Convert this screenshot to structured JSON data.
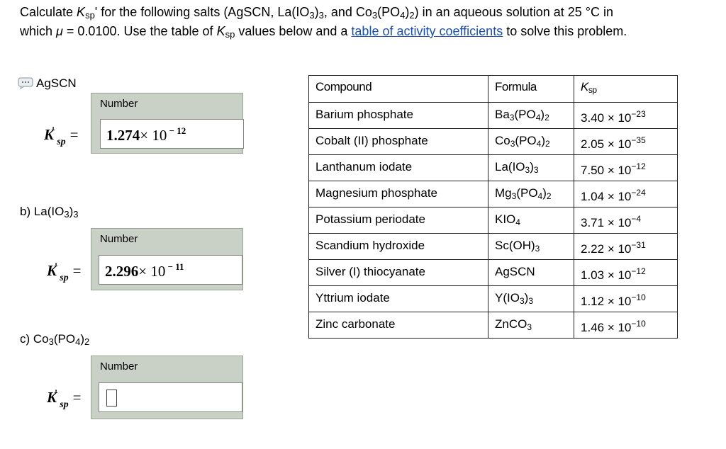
{
  "prompt": {
    "line1_a": "Calculate ",
    "k_symbol": "K",
    "k_sub": "sp",
    "line1_b": "' for the following salts (AgSCN, La(IO",
    "sub3": "3",
    "line1_c": ")",
    "line1_d": ", and Co",
    "line1_e": "(PO",
    "sub4": "4",
    "sub2": "2",
    "line1_f": ") in an aqueous solution at 25 °C in",
    "line2_a": "which ",
    "mu": "μ",
    "line2_b": " = 0.0100. Use the table of ",
    "line2_c": " values below and a ",
    "link_text": "table of activity coefficients",
    "line2_d": " to solve this problem."
  },
  "parts": {
    "a": {
      "label": "AgSCN",
      "box_title": "Number",
      "value_mantissa": "1.274",
      "value_times": "× 10",
      "value_exp": " − 12"
    },
    "b": {
      "label_pre": "b) La(IO",
      "label_sub": "3",
      "label_post": ")",
      "label_sub2": "3",
      "box_title": "Number",
      "value_mantissa": "2.296",
      "value_times": "× 10",
      "value_exp": " − 11"
    },
    "c": {
      "label_pre": "c) Co",
      "label_sub": "3",
      "label_mid": "(PO",
      "label_sub2": "4",
      "label_post": ")",
      "label_sub3": "2",
      "box_title": "Number",
      "value": ""
    }
  },
  "kprime": {
    "k": "K",
    "prime": "'",
    "sub": "sp",
    "eq": "="
  },
  "table": {
    "headers": {
      "compound": "Compound",
      "formula": "Formula",
      "ksp_k": "K",
      "ksp_sub": "sp"
    },
    "rows": [
      {
        "compound": "Barium phosphate",
        "f": [
          "Ba",
          "3",
          "(PO",
          "4",
          ")",
          "2"
        ],
        "mant": "3.40",
        "exp": "−23"
      },
      {
        "compound": "Cobalt (II) phosphate",
        "f": [
          "Co",
          "3",
          "(PO",
          "4",
          ")",
          "2"
        ],
        "mant": "2.05",
        "exp": "−35"
      },
      {
        "compound": "Lanthanum iodate",
        "f": [
          "La(IO",
          "3",
          ")",
          "3",
          "",
          ""
        ],
        "mant": "7.50",
        "exp": "−12"
      },
      {
        "compound": "Magnesium phosphate",
        "f": [
          "Mg",
          "3",
          "(PO",
          "4",
          ")",
          "2"
        ],
        "mant": "1.04",
        "exp": "−24"
      },
      {
        "compound": "Potassium periodate",
        "f": [
          "KIO",
          "4",
          "",
          "",
          "",
          ""
        ],
        "mant": "3.71",
        "exp": "−4"
      },
      {
        "compound": "Scandium hydroxide",
        "f": [
          "Sc(OH)",
          "3",
          "",
          "",
          "",
          ""
        ],
        "mant": "2.22",
        "exp": "−31"
      },
      {
        "compound": "Silver (I) thiocyanate",
        "f": [
          "AgSCN",
          "",
          "",
          "",
          "",
          ""
        ],
        "mant": "1.03",
        "exp": "−12"
      },
      {
        "compound": "Yttrium iodate",
        "f": [
          "Y(IO",
          "3",
          ")",
          "3",
          "",
          ""
        ],
        "mant": "1.12",
        "exp": "−10"
      },
      {
        "compound": "Zinc carbonate",
        "f": [
          "ZnCO",
          "3",
          "",
          "",
          "",
          ""
        ],
        "mant": "1.46",
        "exp": "−10"
      }
    ],
    "times_ten": " × 10"
  }
}
